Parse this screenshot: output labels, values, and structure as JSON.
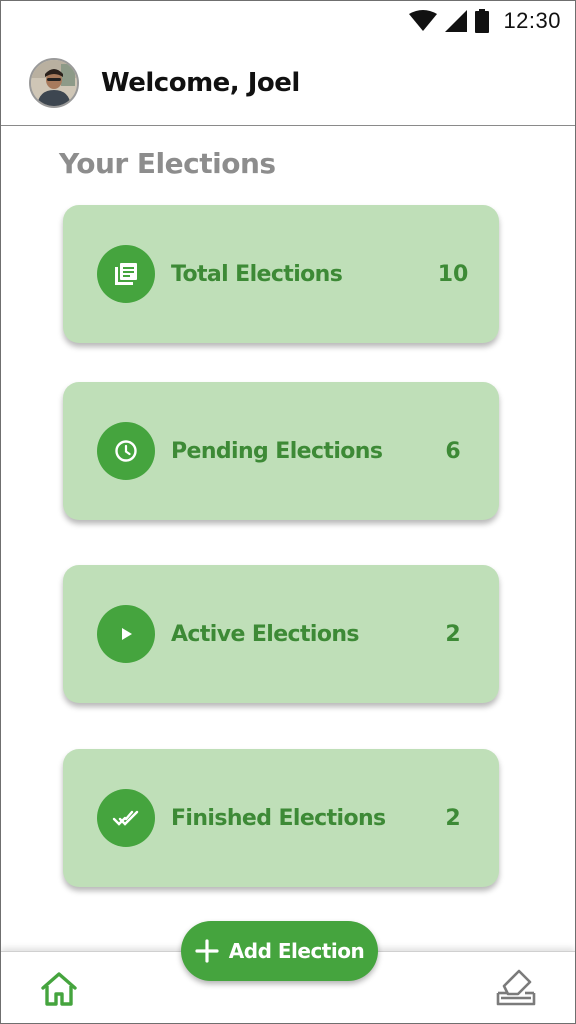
{
  "status_bar": {
    "time": "12:30",
    "icons": [
      "wifi-icon",
      "signal-icon",
      "battery-icon"
    ]
  },
  "header": {
    "welcome_text": "Welcome, Joel",
    "avatar": "profile-photo"
  },
  "section": {
    "title": "Your Elections"
  },
  "cards": [
    {
      "label": "Total Elections",
      "count": "10",
      "icon": "list-icon"
    },
    {
      "label": "Pending Elections",
      "count": "6",
      "icon": "clock-icon"
    },
    {
      "label": "Active Elections",
      "count": "2",
      "icon": "play-icon"
    },
    {
      "label": "Finished Elections",
      "count": "2",
      "icon": "done-all-icon"
    }
  ],
  "fab": {
    "label": "Add Election",
    "icon": "plus-icon"
  },
  "bottom_nav": {
    "items": [
      "home-icon",
      "ballot-icon"
    ]
  },
  "colors": {
    "accent": "#45a43e",
    "card_bg": "#bfdfb8",
    "card_text": "#3d8a36",
    "section_title": "#8d8d8d"
  }
}
